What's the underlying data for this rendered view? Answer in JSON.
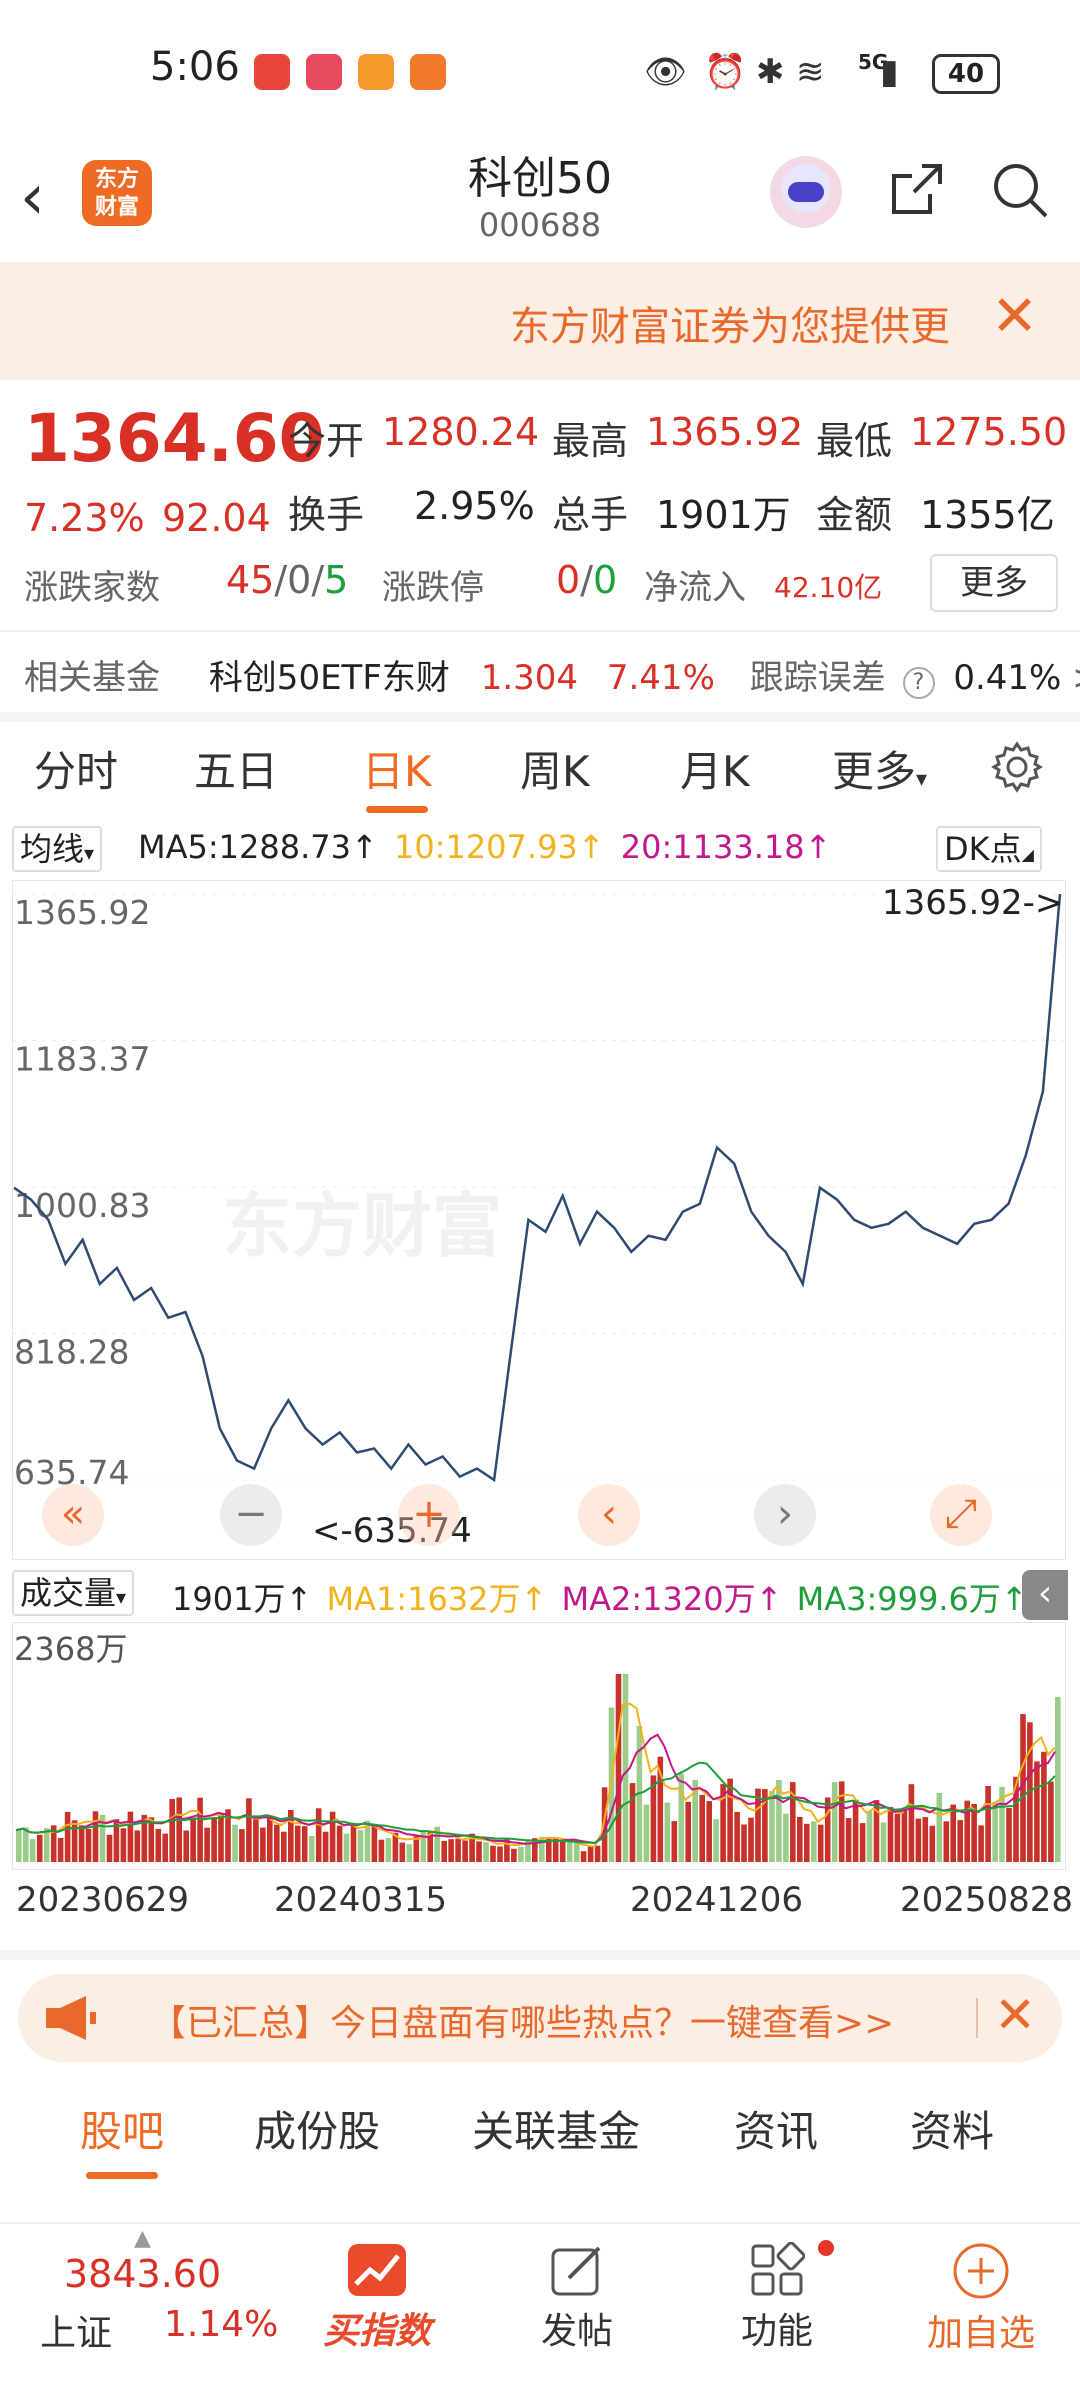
{
  "status_bar": {
    "time": "5:06",
    "network": "5G",
    "battery": "40"
  },
  "header": {
    "title": "科创50",
    "code": "000688",
    "logo_text_line1": "东方",
    "logo_text_line2": "财富"
  },
  "banner": {
    "text": "东方财富证券为您提供更",
    "close": "✕"
  },
  "quote": {
    "price": "1364.60",
    "change_pct": "7.23%",
    "change_val": "92.04",
    "open_label": "今开",
    "open": "1280.24",
    "high_label": "最高",
    "high": "1365.92",
    "low_label": "最低",
    "low": "1275.50",
    "turnover_label": "换手",
    "turnover": "2.95%",
    "volume_label": "总手",
    "volume": "1901万",
    "amount_label": "金额",
    "amount": "1355亿",
    "breadth_label": "涨跌家数",
    "breadth_up": "45",
    "breadth_flat": "0",
    "breadth_down": "5",
    "limit_label": "涨跌停",
    "limit_up": "0",
    "limit_down": "0",
    "netflow_label": "净流入",
    "netflow": "42.10亿",
    "more_button": "更多"
  },
  "fund": {
    "label": "相关基金",
    "name": "科创50ETF东财",
    "price": "1.304",
    "pct": "7.41%",
    "tracking_label": "跟踪误差",
    "tracking": "0.41%",
    "arrow": ">"
  },
  "tabs": [
    "分时",
    "五日",
    "日K",
    "周K",
    "月K",
    "更多"
  ],
  "active_tab": 2,
  "ma_legend": {
    "selector": "均线",
    "ma5": "MA5:1288.73",
    "ma10": "10:1207.93",
    "ma20": "20:1133.18",
    "dk": "DK点",
    "colors": {
      "ma5": "#222222",
      "ma10": "#f1b21a",
      "ma20": "#c2188a"
    }
  },
  "chart": {
    "y_ticks": [
      "1365.92",
      "1183.37",
      "1000.83",
      "818.28",
      "635.74"
    ],
    "high_marker": "1365.92->",
    "low_marker": "<-635.74",
    "watermark": "东方财富",
    "line_color": "#2f4a72"
  },
  "volume": {
    "selector": "成交量",
    "vol": "1901万",
    "ma1": "MA1:1632万",
    "ma2": "MA2:1320万",
    "ma3": "MA3:999.6万",
    "max_label": "2368万",
    "colors": {
      "ma1": "#f1b21a",
      "ma2": "#c2188a",
      "ma3": "#1e9e3a",
      "up": "#c8322a",
      "down": "#9ccc8a"
    }
  },
  "dates": [
    "20230629",
    "20240315",
    "20241206",
    "20250828"
  ],
  "promo": {
    "text": "【已汇总】今日盘面有哪些热点？一键查看>>",
    "close": "✕"
  },
  "bottom_tabs": [
    "股吧",
    "成份股",
    "关联基金",
    "资讯",
    "资料"
  ],
  "bottom_nav": {
    "index_value": "3843.60",
    "index_name": "上证",
    "index_pct": "1.14%",
    "buy_label": "买指数",
    "post_label": "发帖",
    "func_label": "功能",
    "add_label": "加自选"
  },
  "chart_data": {
    "type": "line",
    "ylim": [
      635.74,
      1365.92
    ],
    "x_start": "20230629",
    "x_end": "20250828",
    "series": [
      {
        "values": [
          1000,
          985,
          960,
          905,
          935,
          880,
          900,
          860,
          875,
          838,
          845,
          790,
          700,
          660,
          650,
          700,
          735,
          700,
          680,
          695,
          670,
          675,
          650,
          680,
          655,
          665,
          640,
          650,
          635.74,
          800,
          960,
          945,
          990,
          930,
          970,
          950,
          920,
          940,
          935,
          970,
          980,
          1050,
          1030,
          970,
          940,
          920,
          880,
          1000,
          985,
          960,
          950,
          955,
          970,
          950,
          940,
          930,
          955,
          960,
          980,
          1040,
          1120,
          1365.92
        ]
      }
    ]
  }
}
